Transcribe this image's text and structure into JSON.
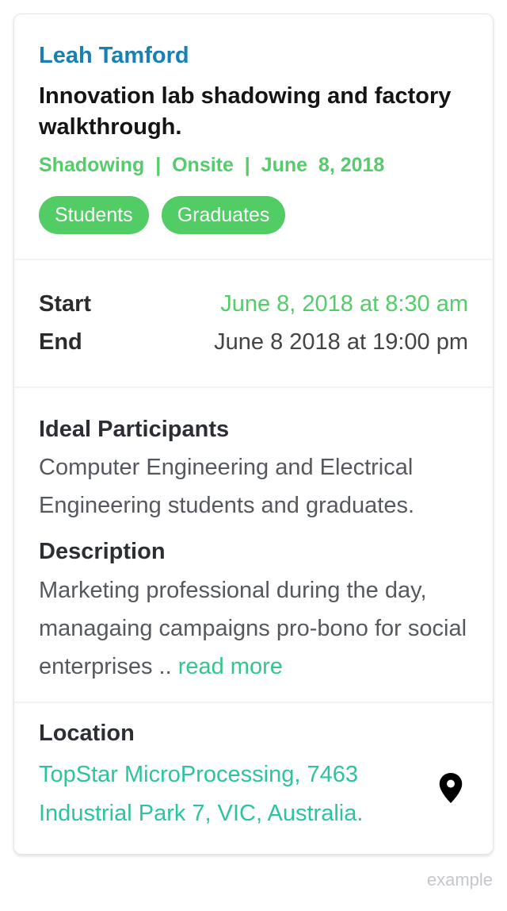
{
  "event": {
    "host": "Leah Tamford",
    "title": "Innovation lab shadowing and factory walkthrough.",
    "meta": "Shadowing  |  Onsite  |  June  8, 2018",
    "tags": [
      "Students",
      "Graduates"
    ]
  },
  "schedule": {
    "start_label": "Start",
    "start_value": "June 8, 2018 at 8:30 am",
    "end_label": "End",
    "end_value": "June 8 2018 at 19:00 pm"
  },
  "details": {
    "participants_heading": "Ideal Participants",
    "participants_text": "Computer Engineering and Electrical Engineering students and graduates.",
    "description_heading": "Description",
    "description_text": "Marketing professional during the day, managaing campaigns pro-bono for social enterprises .. ",
    "read_more": "read more"
  },
  "location": {
    "heading": "Location",
    "address": "TopStar MicroProcessing, 7463 Industrial Park 7, VIC, Australia.",
    "icon": "map-pin-icon"
  },
  "watermark": "example",
  "colors": {
    "host": "#1980b4",
    "meta": "#55cc6a",
    "tag_bg": "#52cc64",
    "start_value": "#55cc6a",
    "link": "#2cc4a0",
    "read_more": "#35c58a"
  }
}
